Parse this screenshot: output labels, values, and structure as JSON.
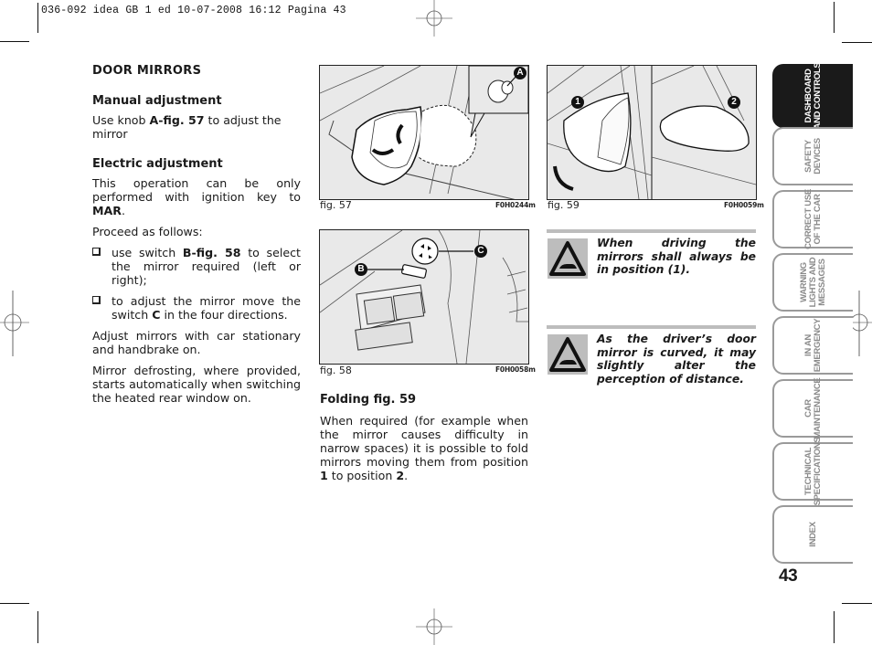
{
  "slug": "036-092 idea GB 1 ed   10-07-2008   16:12   Pagina 43",
  "section": {
    "title": "DOOR MIRRORS",
    "manual": {
      "heading": "Manual adjustment",
      "text_pre": "Use knob ",
      "text_bold": "A-fig. 57",
      "text_post": " to adjust the mirror"
    },
    "electric": {
      "heading": "Electric adjustment",
      "intro_pre": "This operation can be only performed with ignition key to ",
      "intro_bold": "MAR",
      "intro_post": ".",
      "proceed": "Proceed as follows:",
      "bullets": [
        {
          "pre": "use switch ",
          "bold": "B-fig. 58",
          "post": " to select the mirror required (left or right);"
        },
        {
          "pre": "to adjust the mirror move the switch ",
          "bold": "C",
          "post": " in the four directions."
        }
      ],
      "adjust_note": "Adjust mirrors with car stationary and handbrake on.",
      "defrost_note": "Mirror defrosting, where provided, starts automatically when switching the heated rear window on."
    },
    "folding": {
      "heading": "Folding fig. 59",
      "text_pre": "When required (for example when the mirror causes difficulty in narrow spaces) it is possible to fold mirrors moving them from position ",
      "bold1": "1",
      "text_mid": " to position ",
      "bold2": "2",
      "text_post": "."
    }
  },
  "figures": [
    {
      "caption": "fig. 57",
      "code": "F0H0244m",
      "callouts": [
        "A"
      ]
    },
    {
      "caption": "fig. 58",
      "code": "F0H0058m",
      "callouts": [
        "B",
        "C"
      ]
    },
    {
      "caption": "fig. 59",
      "code": "F0H0059m",
      "callouts": [
        "1",
        "2"
      ]
    }
  ],
  "warnings": [
    {
      "icon": "warning-triangle-car-icon",
      "text": "When driving the mirrors shall always be in position (1)."
    },
    {
      "icon": "warning-triangle-car-icon",
      "text": "As the driver’s door mirror is curved, it may slightly alter the perception of distance."
    }
  ],
  "tabs": [
    {
      "line1": "DASHBOARD",
      "line2": "AND CONTROLS",
      "active": true
    },
    {
      "line1": "SAFETY",
      "line2": "DEVICES",
      "active": false
    },
    {
      "line1": "CORRECT USE",
      "line2": "OF THE CAR",
      "active": false
    },
    {
      "line1": "WARNING",
      "line2": "LIGHTS AND",
      "line3": "MESSAGES",
      "active": false
    },
    {
      "line1": "IN AN",
      "line2": "EMERGENCY",
      "active": false
    },
    {
      "line1": "CAR",
      "line2": "MAINTENANCE",
      "active": false
    },
    {
      "line1": "TECHNICAL",
      "line2": "SPECIFICATIONS",
      "active": false
    },
    {
      "line1": "INDEX",
      "active": false
    }
  ],
  "page_number": "43",
  "colors": {
    "ink": "#1a1a1a",
    "tab_grey": "#9a9a9a",
    "warn_grey": "#bdbdbd",
    "figure_bg": "#e9e9e9"
  }
}
